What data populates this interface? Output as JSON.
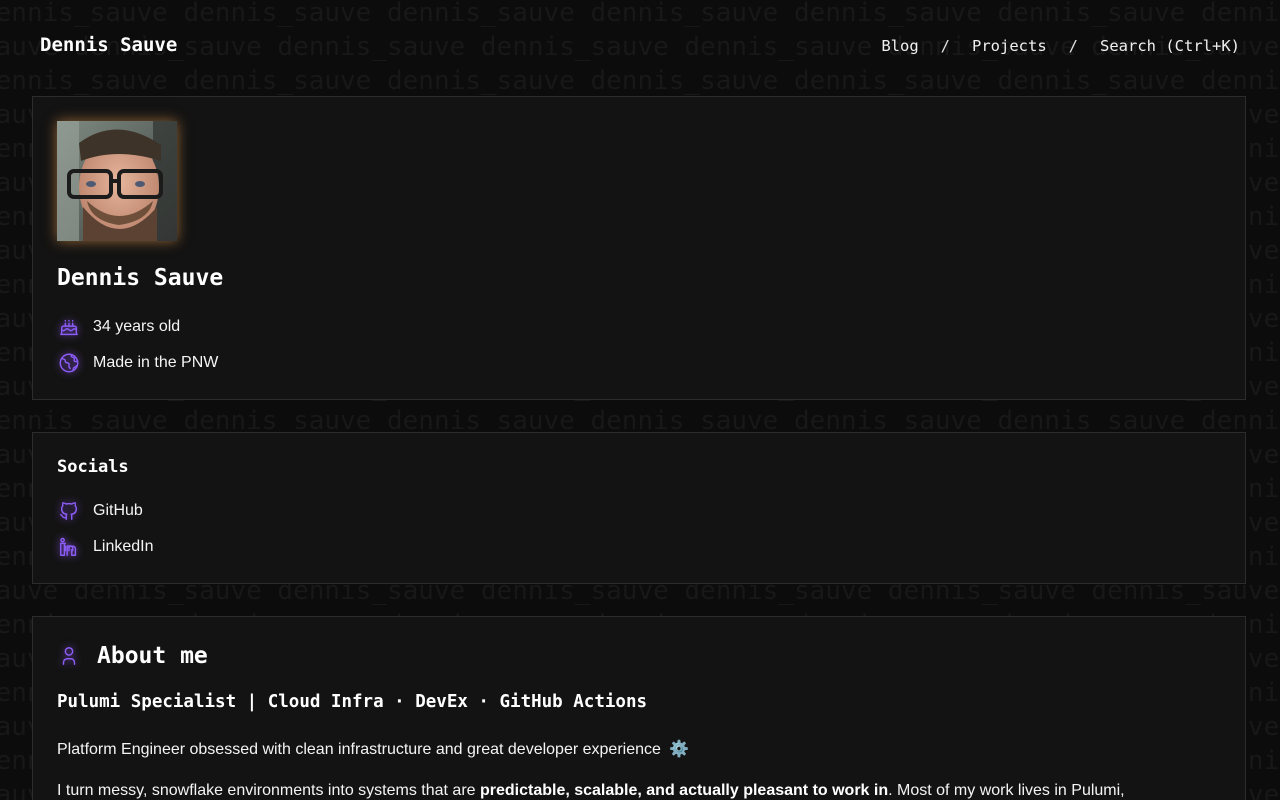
{
  "header": {
    "site_title": "Dennis Sauve",
    "nav": {
      "blog": "Blog",
      "sep1": "/",
      "projects": "Projects",
      "sep2": "/",
      "search": "Search (Ctrl+K)"
    }
  },
  "background": {
    "pattern_lines": [
      "dennis_sauve dennis_sauve dennis_sauve dennis_sauve dennis_sauve dennis_sauve dennis_sauve",
      "sauve dennis_sauve dennis_sauve dennis_sauve dennis_sauve dennis_sauve dennis_sauve dennis_",
      "dennis_sauve dennis_sauve dennis_sauve dennis_sauve dennis_sauve dennis_sauve dennis_sauve",
      "sauve dennis_sauve dennis_sauve dennis_sauve dennis_sauve dennis_sauve dennis_sauve dennis_",
      "dennis_sauve dennis_sauve dennis_sauve dennis_sauve dennis_sauve dennis_sauve dennis_sauve",
      "sauve dennis_sauve dennis_sauve dennis_sauve dennis_sauve dennis_sauve dennis_sauve dennis_",
      "dennis_sauve dennis_sauve dennis_sauve dennis_sauve dennis_sauve dennis_sauve dennis_sauve",
      "sauve dennis_sauve dennis_sauve dennis_sauve dennis_sauve dennis_sauve dennis_sauve dennis_",
      "dennis_sauve dennis_sauve dennis_sauve dennis_sauve dennis_sauve dennis_sauve dennis_sauve",
      "sauve dennis_sauve dennis_sauve dennis_sauve dennis_sauve dennis_sauve dennis_sauve dennis_",
      "dennis_sauve dennis_sauve dennis_sauve dennis_sauve dennis_sauve dennis_sauve dennis_sauve",
      "sauve dennis_sauve dennis_sauve dennis_sauve dennis_sauve dennis_sauve dennis_sauve dennis_",
      "dennis_sauve dennis_sauve dennis_sauve dennis_sauve dennis_sauve dennis_sauve dennis_sauve",
      "sauve dennis_sauve dennis_sauve dennis_sauve dennis_sauve dennis_sauve dennis_sauve dennis_",
      "dennis_sauve dennis_sauve dennis_sauve dennis_sauve dennis_sauve dennis_sauve dennis_sauve",
      "sauve dennis_sauve dennis_sauve dennis_sauve dennis_sauve dennis_sauve dennis_sauve dennis_",
      "dennis_sauve dennis_sauve dennis_sauve dennis_sauve dennis_sauve dennis_sauve dennis_sauve",
      "sauve dennis_sauve dennis_sauve dennis_sauve dennis_sauve dennis_sauve dennis_sauve dennis_",
      "dennis_sauve dennis_sauve dennis_sauve dennis_sauve dennis_sauve dennis_sauve dennis_sauve",
      "sauve dennis_sauve dennis_sauve dennis_sauve dennis_sauve dennis_sauve dennis_sauve dennis_",
      "dennis_sauve dennis_sauve dennis_sauve dennis_sauve dennis_sauve dennis_sauve dennis_sauve",
      "sauve dennis_sauve dennis_sauve dennis_sauve dennis_sauve dennis_sauve dennis_sauve dennis_",
      "dennis_sauve dennis_sauve dennis_sauve dennis_sauve dennis_sauve dennis_sauve dennis_sauve",
      "sauve dennis_sauve dennis_sauve dennis_sauve dennis_sauve dennis_sauve dennis_sauve dennis_"
    ]
  },
  "profile": {
    "avatar_icon": "profile-photo",
    "name": "Dennis Sauve",
    "age_icon": "birthday-cake-icon",
    "age_text": "34 years old",
    "location_icon": "globe-icon",
    "location_text": "Made in the PNW"
  },
  "socials": {
    "title": "Socials",
    "links": [
      {
        "icon": "github-icon",
        "label": "GitHub"
      },
      {
        "icon": "linkedin-icon",
        "label": "LinkedIn"
      }
    ]
  },
  "about": {
    "icon": "user-icon",
    "title": "About me",
    "subtitle": "Pulumi Specialist | Cloud Infra · DevEx · GitHub Actions",
    "paragraph1": "Platform Engineer obsessed with clean infrastructure and great developer experience",
    "paragraph1_emoji": "⚙️",
    "paragraph2_before": "I turn messy, snowflake environments into systems that are ",
    "paragraph2_bold": "predictable, scalable, and actually pleasant to work in",
    "paragraph2_after": ". Most of my work lives in Pulumi,"
  },
  "colors": {
    "background": "#0c0c0c",
    "card": "#131313",
    "card_border": "#2c2c2c",
    "accent_purple": "#8b5cf6",
    "text": "#f4f4f4"
  }
}
